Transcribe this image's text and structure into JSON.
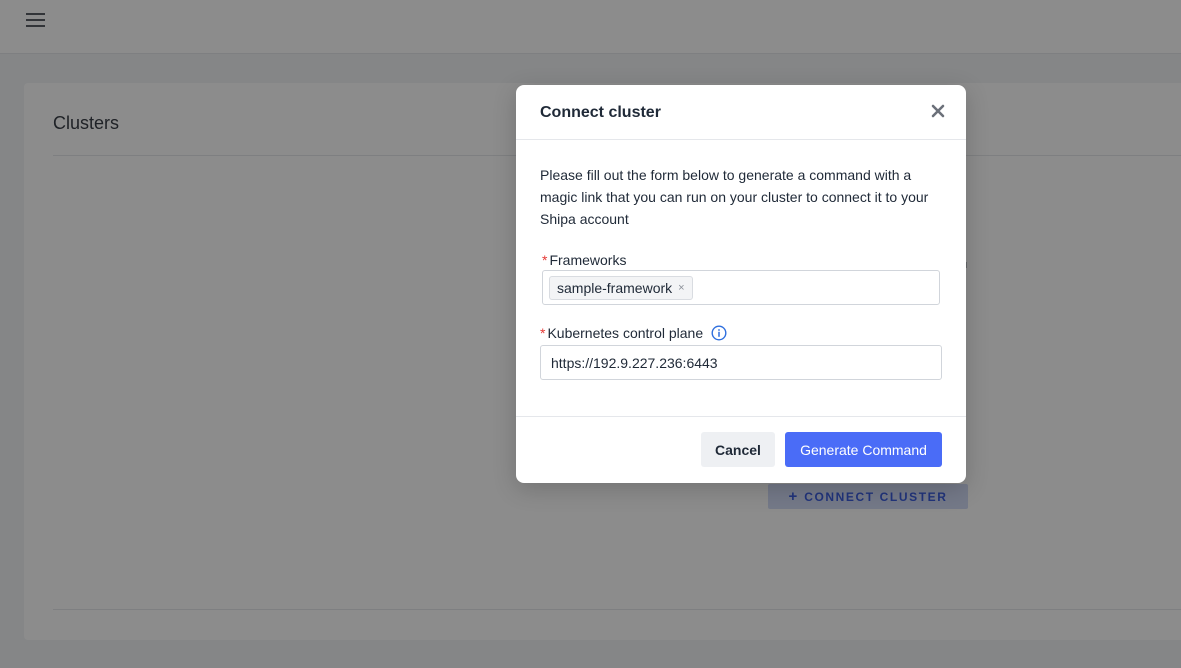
{
  "topbar": {
    "menu_icon": "hamburger-menu-icon"
  },
  "clusters_page": {
    "title": "Clusters",
    "connect_button_label": "CONNECT CLUSTER",
    "connect_button_icon": "plus-icon",
    "accent_color": "#3d5fe0"
  },
  "modal": {
    "title": "Connect cluster",
    "close_icon": "close-icon",
    "description": "Please fill out the form below to generate a command with a magic link that you can run on your cluster to connect it to your Shipa account",
    "frameworks": {
      "label": "Frameworks",
      "required_mark": "*",
      "selected_tags": [
        "sample-framework"
      ],
      "tag_remove_symbol": "×"
    },
    "control_plane": {
      "label": "Kubernetes control plane",
      "required_mark": "*",
      "info_icon": "info-icon",
      "value": "https://192.9.227.236:6443"
    },
    "cancel_label": "Cancel",
    "generate_label": "Generate Command",
    "primary_color": "#4a6cf7",
    "required_color": "#e53935"
  }
}
